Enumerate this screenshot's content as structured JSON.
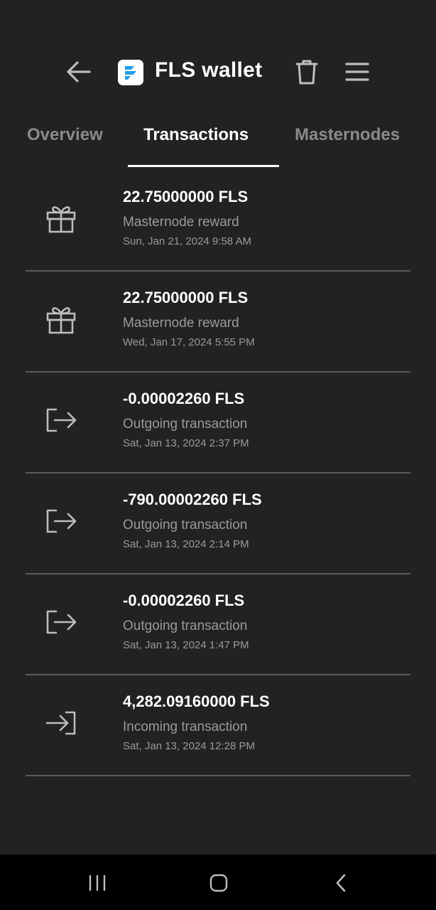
{
  "header": {
    "title": "FLS wallet",
    "back_icon": "arrow-left-icon",
    "logo_icon": "fls-logo-icon",
    "trash_icon": "trash-icon",
    "menu_icon": "hamburger-menu-icon",
    "brand_color": "#1ea0e6"
  },
  "tabs": [
    {
      "label": "Overview",
      "active": false
    },
    {
      "label": "Transactions",
      "active": true
    },
    {
      "label": "Masternodes",
      "active": false
    }
  ],
  "transactions": [
    {
      "amount": "22.75000000 FLS",
      "type": "Masternode reward",
      "date": "Sun, Jan 21, 2024 9:58 AM",
      "icon": "gift-icon"
    },
    {
      "amount": "22.75000000 FLS",
      "type": "Masternode reward",
      "date": "Wed, Jan 17, 2024 5:55 PM",
      "icon": "gift-icon"
    },
    {
      "amount": "-0.00002260 FLS",
      "type": "Outgoing transaction",
      "date": "Sat, Jan 13, 2024 2:37 PM",
      "icon": "logout-arrow-icon"
    },
    {
      "amount": "-790.00002260 FLS",
      "type": "Outgoing transaction",
      "date": "Sat, Jan 13, 2024 2:14 PM",
      "icon": "logout-arrow-icon"
    },
    {
      "amount": "-0.00002260 FLS",
      "type": "Outgoing transaction",
      "date": "Sat, Jan 13, 2024 1:47 PM",
      "icon": "logout-arrow-icon"
    },
    {
      "amount": "4,282.09160000 FLS",
      "type": "Incoming transaction",
      "date": "Sat, Jan 13, 2024 12:28 PM",
      "icon": "login-arrow-icon"
    }
  ],
  "navbar": {
    "recents_icon": "recents-icon",
    "home_icon": "home-icon",
    "back_icon": "nav-back-icon"
  }
}
